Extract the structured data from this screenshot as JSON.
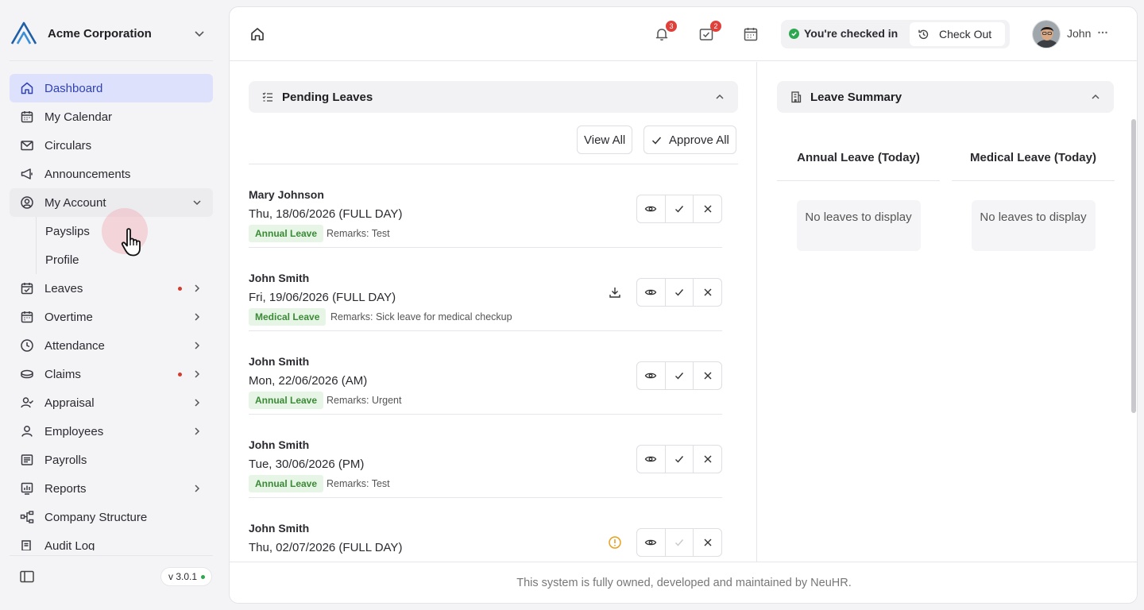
{
  "org": {
    "name": "Acme Corporation"
  },
  "nav": {
    "items": [
      {
        "label": "Dashboard"
      },
      {
        "label": "My Calendar"
      },
      {
        "label": "Circulars"
      },
      {
        "label": "Announcements"
      },
      {
        "label": "My Account"
      },
      {
        "label": "Leaves"
      },
      {
        "label": "Overtime"
      },
      {
        "label": "Attendance"
      },
      {
        "label": "Claims"
      },
      {
        "label": "Appraisal"
      },
      {
        "label": "Employees"
      },
      {
        "label": "Payrolls"
      },
      {
        "label": "Reports"
      },
      {
        "label": "Company Structure"
      },
      {
        "label": "Audit Log"
      }
    ],
    "account_sub": [
      {
        "label": "Payslips"
      },
      {
        "label": "Profile"
      }
    ]
  },
  "version": "v 3.0.1",
  "topbar": {
    "notifications_count": "3",
    "tasks_count": "2",
    "checkin_status": "You're checked in",
    "checkout_label": "Check Out",
    "user_name": "John"
  },
  "pending": {
    "title": "Pending Leaves",
    "view_all": "View All",
    "approve_all": "Approve All",
    "items": [
      {
        "name": "Mary Johnson",
        "date": "Thu, 18/06/2026 (FULL DAY)",
        "type": "Annual Leave",
        "remarks": "Remarks: Test"
      },
      {
        "name": "John Smith",
        "date": "Fri, 19/06/2026 (FULL DAY)",
        "type": "Medical Leave",
        "remarks": "Remarks: Sick leave for medical checkup"
      },
      {
        "name": "John Smith",
        "date": "Mon, 22/06/2026 (AM)",
        "type": "Annual Leave",
        "remarks": "Remarks: Urgent"
      },
      {
        "name": "John Smith",
        "date": "Tue, 30/06/2026 (PM)",
        "type": "Annual Leave",
        "remarks": "Remarks: Test"
      },
      {
        "name": "John Smith",
        "date": "Thu, 02/07/2026 (FULL DAY)",
        "type": "",
        "remarks": ""
      }
    ]
  },
  "summary": {
    "title": "Leave Summary",
    "annual_title": "Annual Leave (Today)",
    "medical_title": "Medical Leave (Today)",
    "empty_text": "No leaves to display"
  },
  "footer": {
    "text": "This system is fully owned, developed and maintained by NeuHR."
  },
  "colors": {
    "accent": "#3142b4",
    "active_bg": "#dde1fb",
    "success": "#2da850",
    "danger": "#e0403a",
    "warning": "#e6a020"
  }
}
